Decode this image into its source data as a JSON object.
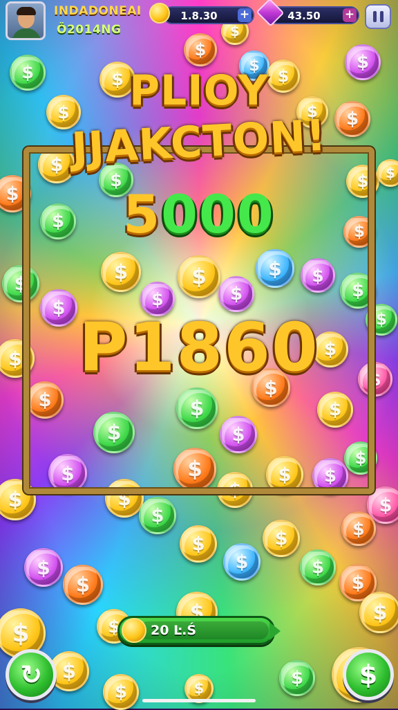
{
  "player": {
    "name": "INDADONEAI",
    "subtitle": "Ö2014NG"
  },
  "currency": {
    "gold_value": "1.8.30",
    "gems_value": "43.50",
    "add_symbol": "+"
  },
  "jackpot": {
    "line1": "PLIOY",
    "line2": "JJAKCTON!",
    "amount_first_digit": "5",
    "amount_rest": "000",
    "prize": "P1860"
  },
  "progress": {
    "label": "20",
    "suffix": "Ŀ.Ś",
    "fill_fraction": 0.9
  },
  "icons": {
    "coin_symbol": "$",
    "refresh": "refresh-icon",
    "collect": "dollar-coin-icon"
  },
  "colors": {
    "gold": "#ffc62a",
    "green": "#45e84a",
    "frame": "#b08a3a"
  }
}
